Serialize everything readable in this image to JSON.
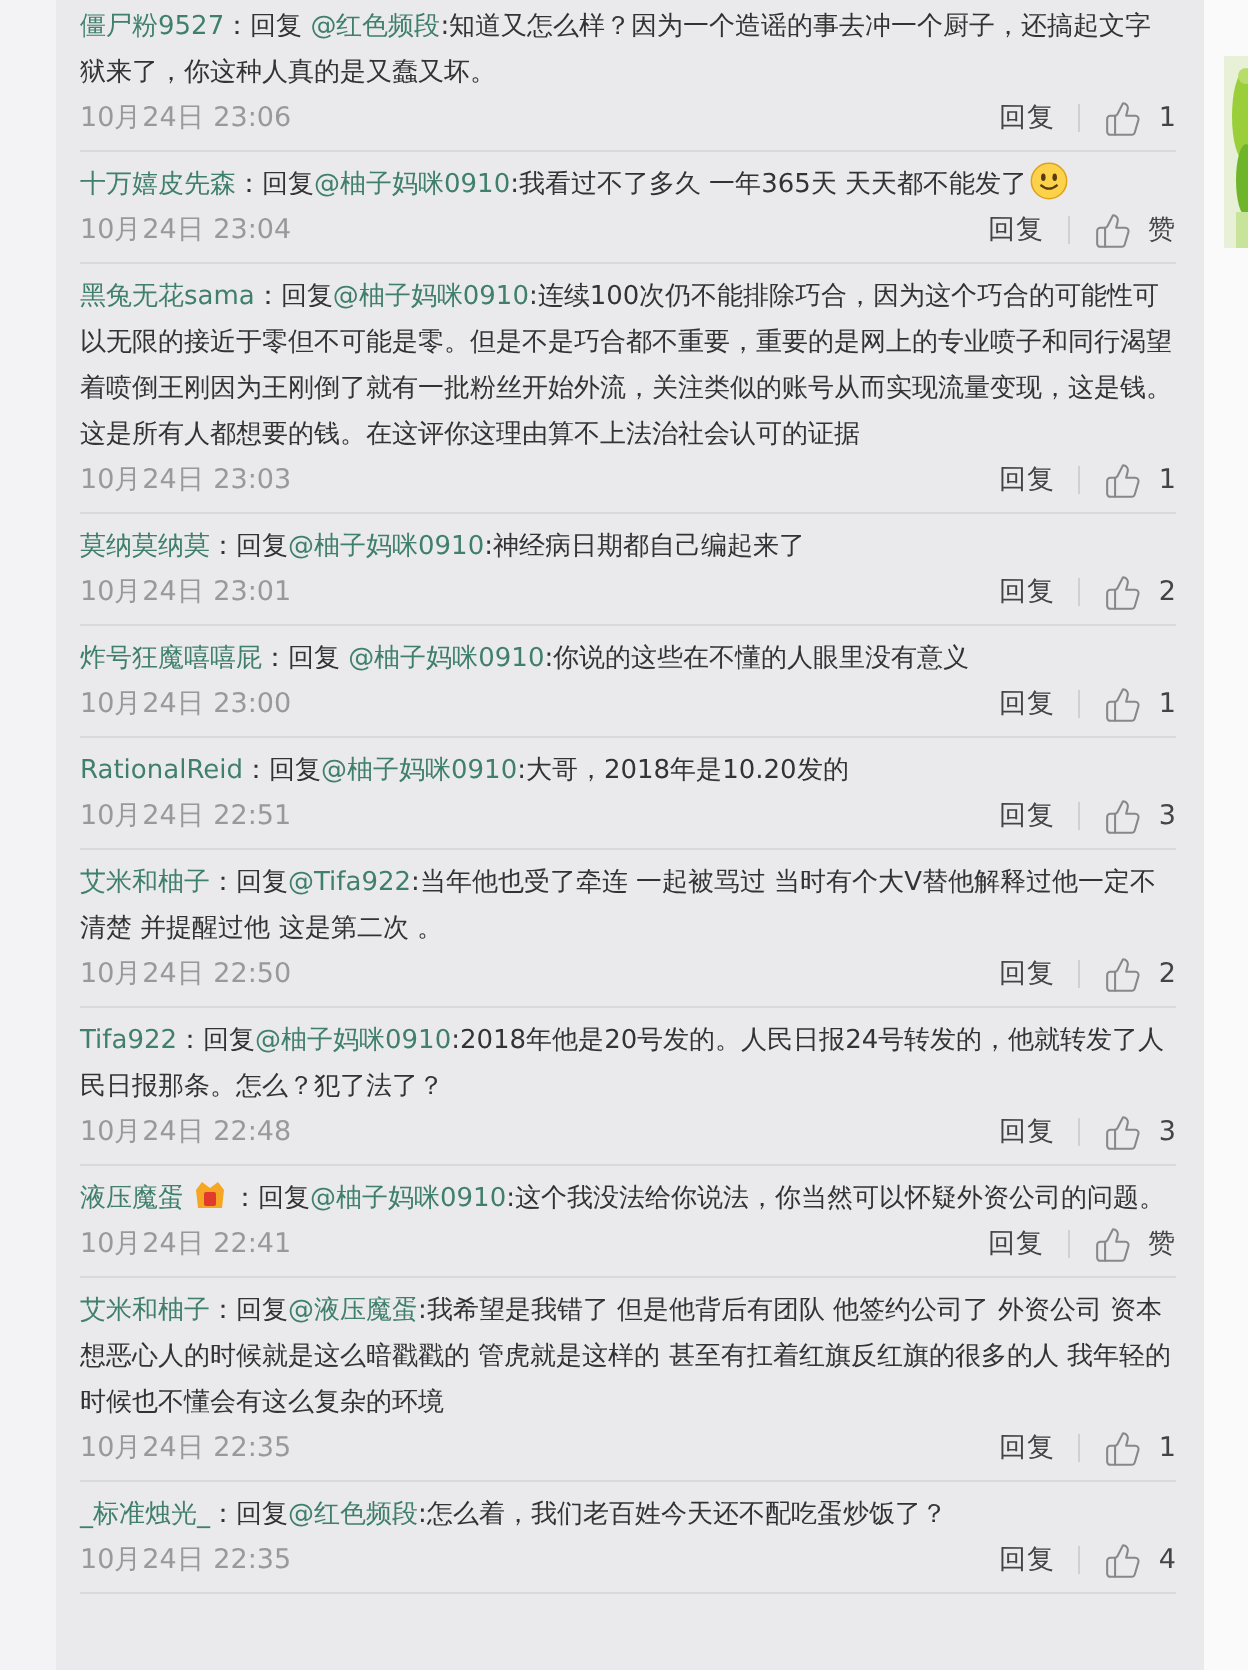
{
  "comments": [
    {
      "user": "僵尸粉9527",
      "colon": "：",
      "prefix": "回复 ",
      "mention": "@红色频段",
      "body": ":知道又怎么样？因为一个造谣的事去冲一个厨子，还搞起文字狱来了，你这种人真的是又蠢又坏。",
      "emoji": false,
      "badge": false,
      "time": "10月24日 23:06",
      "reply": "回复",
      "likes": "1"
    },
    {
      "user": "十万嬉皮先森",
      "colon": "：",
      "prefix": "回复",
      "mention": "@柚子妈咪0910",
      "body": ":我看过不了多久 一年365天 天天都不能发了",
      "emoji": true,
      "badge": false,
      "time": "10月24日 23:04",
      "reply": "回复",
      "likes": "赞"
    },
    {
      "user": "黑兔无花sama",
      "colon": "：",
      "prefix": "回复",
      "mention": "@柚子妈咪0910",
      "body": ":连续100次仍不能排除巧合，因为这个巧合的可能性可以无限的接近于零但不可能是零。但是不是巧合都不重要，重要的是网上的专业喷子和同行渴望着喷倒王刚因为王刚倒了就有一批粉丝开始外流，关注类似的账号从而实现流量变现，这是钱。这是所有人都想要的钱。在这评你这理由算不上法治社会认可的证据",
      "emoji": false,
      "badge": false,
      "time": "10月24日 23:03",
      "reply": "回复",
      "likes": "1"
    },
    {
      "user": "莫纳莫纳莫",
      "colon": "：",
      "prefix": "回复",
      "mention": "@柚子妈咪0910",
      "body": ":神经病日期都自己编起来了",
      "emoji": false,
      "badge": false,
      "time": "10月24日 23:01",
      "reply": "回复",
      "likes": "2"
    },
    {
      "user": "炸号狂魔嘻嘻屁",
      "colon": "：",
      "prefix": "回复 ",
      "mention": "@柚子妈咪0910",
      "body": ":你说的这些在不懂的人眼里没有意义",
      "emoji": false,
      "badge": false,
      "time": "10月24日 23:00",
      "reply": "回复",
      "likes": "1"
    },
    {
      "user": "RationalReid",
      "colon": "：",
      "prefix": "回复",
      "mention": "@柚子妈咪0910",
      "body": ":大哥，2018年是10.20发的",
      "emoji": false,
      "badge": false,
      "time": "10月24日 22:51",
      "reply": "回复",
      "likes": "3"
    },
    {
      "user": "艾米和柚子",
      "colon": "：",
      "prefix": "回复",
      "mention": "@Tifa922",
      "body": ":当年他也受了牵连 一起被骂过 当时有个大V替他解释过他一定不清楚 并提醒过他  这是第二次 。",
      "emoji": false,
      "badge": false,
      "time": "10月24日 22:50",
      "reply": "回复",
      "likes": "2"
    },
    {
      "user": "Tifa922",
      "colon": "：",
      "prefix": "回复",
      "mention": "@柚子妈咪0910",
      "body": ":2018年他是20号发的。人民日报24号转发的，他就转发了人民日报那条。怎么？犯了法了？",
      "emoji": false,
      "badge": false,
      "time": "10月24日 22:48",
      "reply": "回复",
      "likes": "3"
    },
    {
      "user": "液压魔蛋",
      "colon": "：",
      "prefix": "回复",
      "mention": "@柚子妈咪0910",
      "body": ":这个我没法给你说法，你当然可以怀疑外资公司的问题。",
      "emoji": false,
      "badge": true,
      "time": "10月24日 22:41",
      "reply": "回复",
      "likes": "赞"
    },
    {
      "user": "艾米和柚子",
      "colon": "：",
      "prefix": "回复",
      "mention": "@液压魔蛋",
      "body": ":我希望是我错了 但是他背后有团队 他签约公司了 外资公司  资本想恶心人的时候就是这么暗戳戳的  管虎就是这样的 甚至有扛着红旗反红旗的很多的人 我年轻的时候也不懂会有这么复杂的环境",
      "emoji": false,
      "badge": false,
      "time": "10月24日 22:35",
      "reply": "回复",
      "likes": "1"
    },
    {
      "user": "_标准烛光_",
      "colon": "：",
      "prefix": "回复",
      "mention": "@红色频段",
      "body": ":怎么着，我们老百姓今天还不配吃蛋炒饭了？",
      "emoji": false,
      "badge": false,
      "time": "10月24日 22:35",
      "reply": "回复",
      "likes": "4"
    }
  ]
}
